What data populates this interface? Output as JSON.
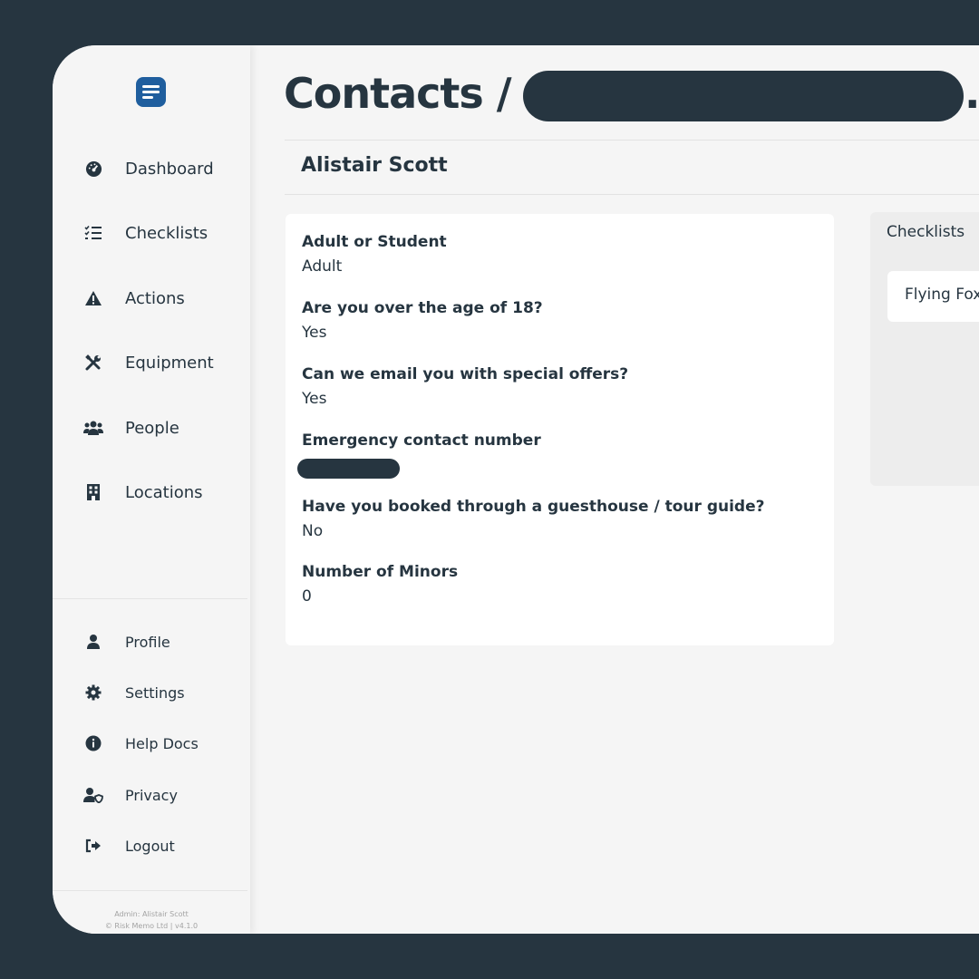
{
  "sidebar": {
    "logo_icon": "notes-app-icon",
    "nav": [
      {
        "label": "Dashboard",
        "icon": "gauge-icon"
      },
      {
        "label": "Checklists",
        "icon": "checklist-icon"
      },
      {
        "label": "Actions",
        "icon": "warning-icon"
      },
      {
        "label": "Equipment",
        "icon": "tools-icon"
      },
      {
        "label": "People",
        "icon": "people-icon"
      },
      {
        "label": "Locations",
        "icon": "building-icon"
      }
    ],
    "secondary": [
      {
        "label": "Profile",
        "icon": "user-icon"
      },
      {
        "label": "Settings",
        "icon": "gear-icon"
      },
      {
        "label": "Help Docs",
        "icon": "info-icon"
      },
      {
        "label": "Privacy",
        "icon": "user-shield-icon"
      },
      {
        "label": "Logout",
        "icon": "logout-icon"
      }
    ],
    "footer_admin": "Admin: Alistair Scott",
    "footer_copyright": "© Risk Memo Ltd | v4.1.0"
  },
  "header": {
    "title_prefix": "Contacts /",
    "title_suffix": ".c"
  },
  "contact": {
    "name": "Alistair Scott",
    "fields": [
      {
        "label": "Adult or Student",
        "value": "Adult"
      },
      {
        "label": "Are you over the age of 18?",
        "value": "Yes"
      },
      {
        "label": "Can we email you with special offers?",
        "value": "Yes"
      },
      {
        "label": "Emergency contact number",
        "value": ""
      },
      {
        "label": "Have you booked through a guesthouse / tour guide?",
        "value": "No"
      },
      {
        "label": "Number of Minors",
        "value": "0"
      }
    ]
  },
  "checklists_panel": {
    "title": "Checklists",
    "items": [
      "Flying Fox"
    ]
  },
  "colors": {
    "background": "#263540",
    "surface": "#f5f5f5",
    "card": "#ffffff",
    "text": "#263540",
    "brand": "#1f5e9e"
  }
}
